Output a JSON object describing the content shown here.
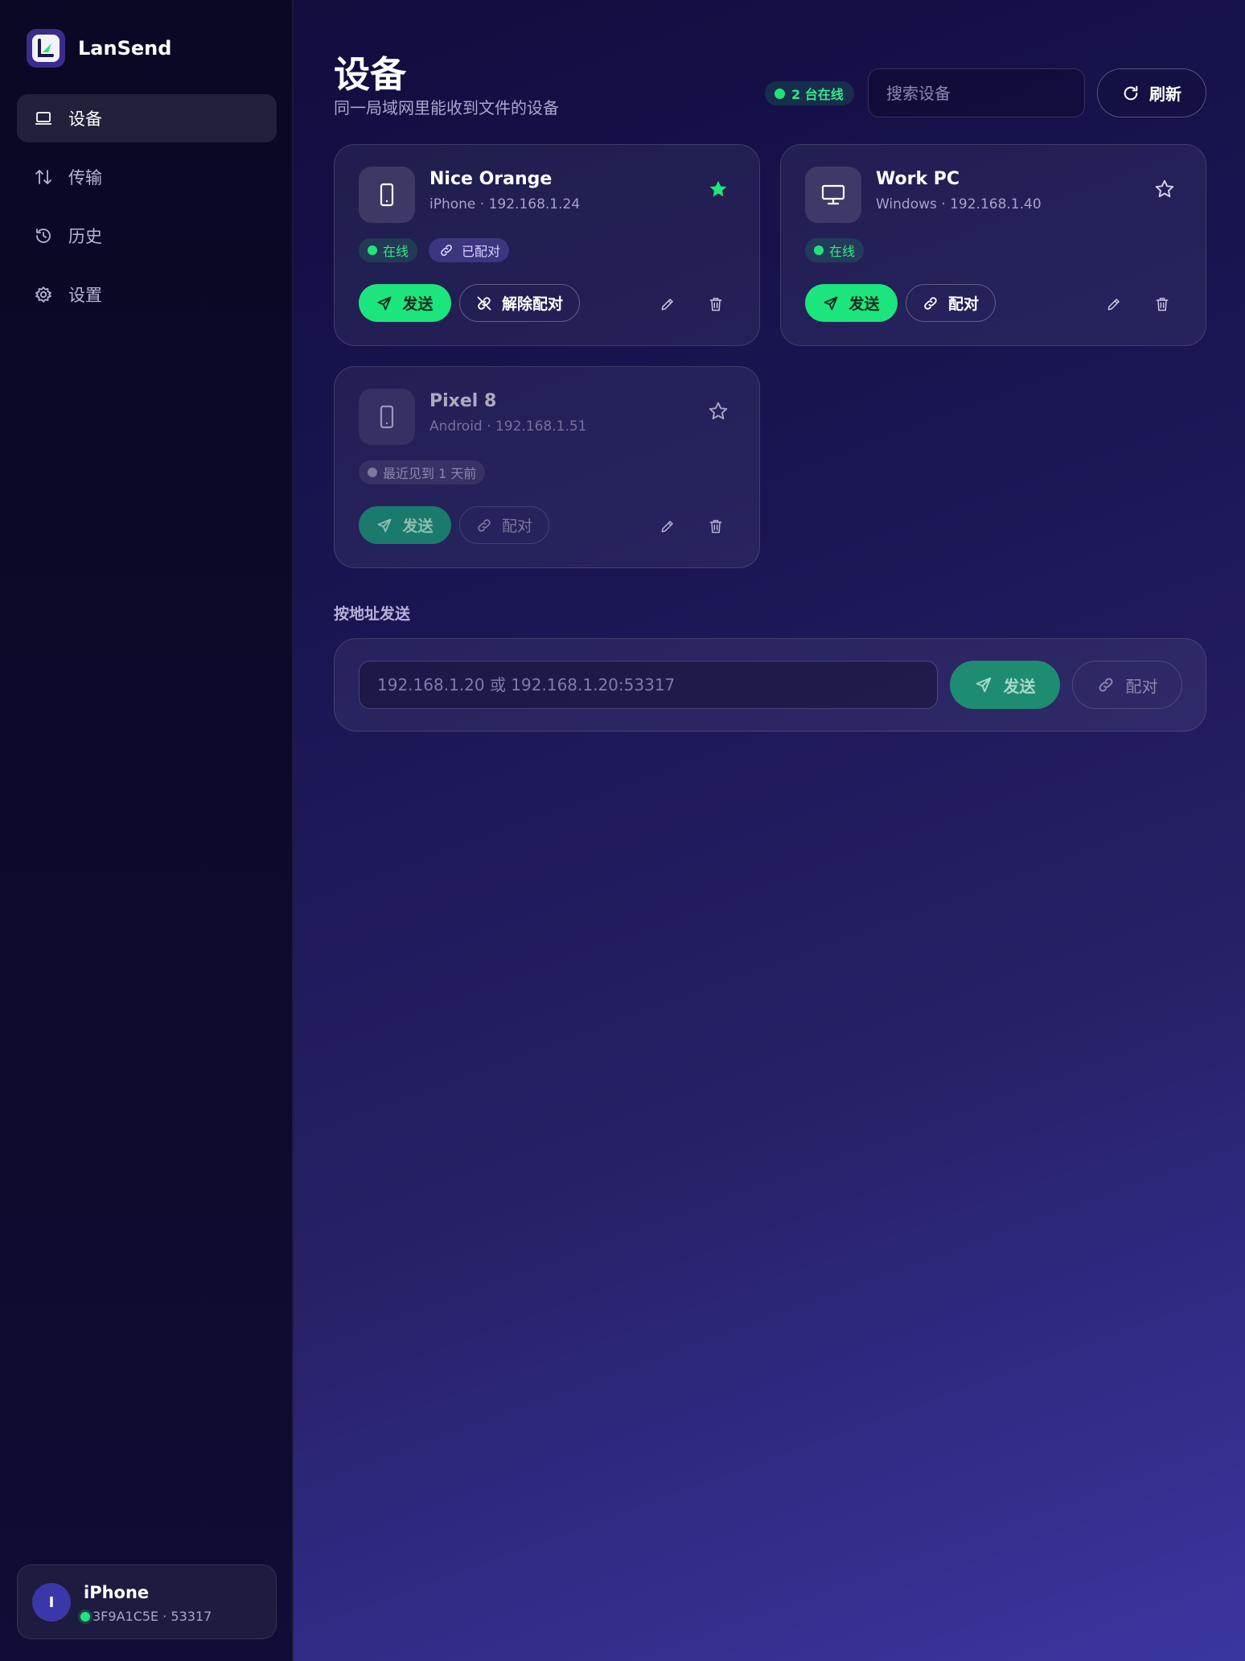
{
  "app": {
    "name": "LanSend"
  },
  "sidebar": {
    "items": [
      {
        "label": "设备",
        "icon": "laptop-icon",
        "active": true
      },
      {
        "label": "传输",
        "icon": "transfer-arrows-icon",
        "active": false
      },
      {
        "label": "历史",
        "icon": "history-icon",
        "active": false
      },
      {
        "label": "设置",
        "icon": "settings-icon",
        "active": false
      }
    ]
  },
  "me": {
    "avatar_letter": "I",
    "name": "iPhone",
    "id": "3F9A1C5E · 53317"
  },
  "header": {
    "title": "设备",
    "subtitle": "同一局域网里能收到文件的设备",
    "online_count": "2 台在线",
    "search_placeholder": "搜索设备",
    "refresh_label": "刷新"
  },
  "devices": [
    {
      "name": "Nice Orange",
      "meta": "iPhone · 192.168.1.24",
      "type": "phone",
      "favorite": true,
      "status": "在线",
      "paired_badge": "已配对",
      "send_label": "发送",
      "pair_action": "解除配对"
    },
    {
      "name": "Work PC",
      "meta": "Windows · 192.168.1.40",
      "type": "desktop",
      "favorite": false,
      "status": "在线",
      "send_label": "发送",
      "pair_action": "配对"
    },
    {
      "name": "Pixel 8",
      "meta": "Android · 192.168.1.51",
      "type": "phone",
      "favorite": false,
      "status": "最近见到 1 天前",
      "send_label": "发送",
      "pair_action": "配对"
    }
  ],
  "address_send": {
    "label": "按地址发送",
    "placeholder": "192.168.1.20 或 192.168.1.20:53317",
    "send_label": "发送",
    "pair_label": "配对"
  },
  "colors": {
    "accent": "#1de57d",
    "online": "#22e27a",
    "avatar": "#3a38a8"
  }
}
